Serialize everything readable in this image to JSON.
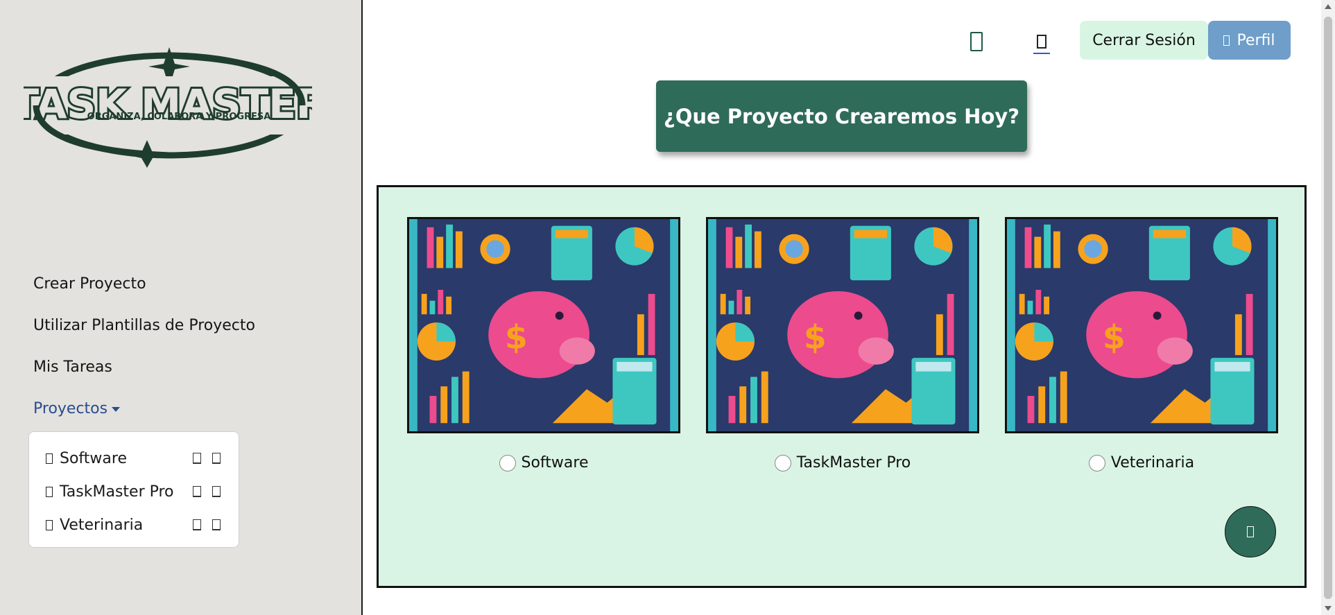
{
  "logo": {
    "title": "TASK MASTER",
    "tagline": "ORGANIZA, COLABORA Y PROGRESA"
  },
  "nav": {
    "items": [
      {
        "label": "Crear Proyecto"
      },
      {
        "label": "Utilizar Plantillas de Proyecto"
      },
      {
        "label": "Mis Tareas"
      }
    ],
    "dropdown": {
      "label": "Proyectos",
      "projects": [
        {
          "name": "Software"
        },
        {
          "name": "TaskMaster Pro"
        },
        {
          "name": "Veterinaria"
        }
      ]
    }
  },
  "header": {
    "logout_label": "Cerrar Sesión",
    "profile_label": "Perfil"
  },
  "hero": {
    "title": "¿Que Proyecto Crearemos Hoy?"
  },
  "projects": [
    {
      "name": "Software"
    },
    {
      "name": "TaskMaster Pro"
    },
    {
      "name": "Veterinaria"
    }
  ],
  "colors": {
    "brand_green": "#2f6b59",
    "panel_bg": "#d9f4e4",
    "sidebar_bg": "#e3e2de",
    "profile_blue": "#6e9ec9"
  }
}
